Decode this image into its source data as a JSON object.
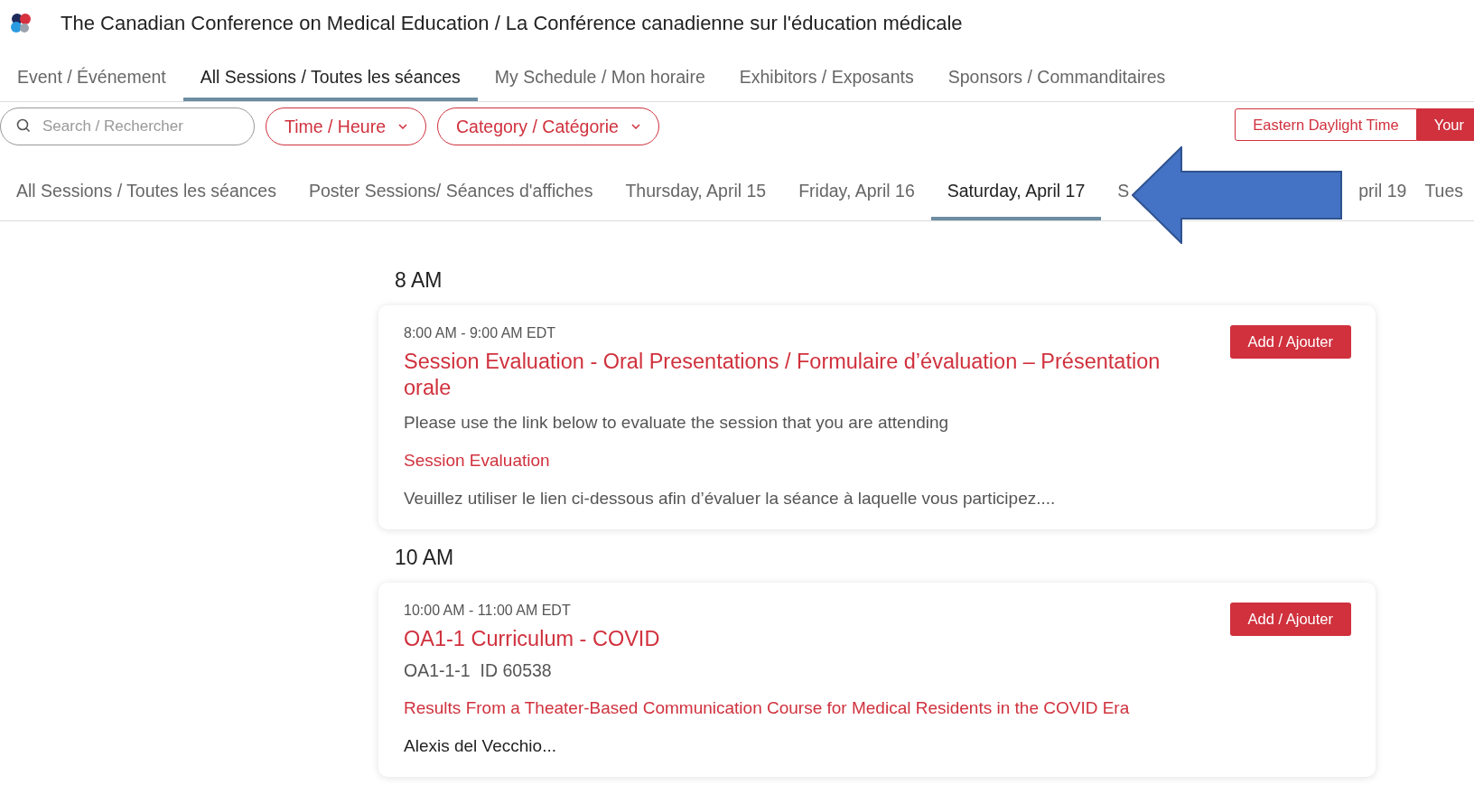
{
  "header": {
    "title": "The Canadian Conference on Medical Education / La Conférence canadienne sur l'éducation médicale"
  },
  "nav_tabs": [
    {
      "label": "Event / Événement",
      "selected": false
    },
    {
      "label": "All Sessions / Toutes les séances",
      "selected": true
    },
    {
      "label": "My Schedule / Mon horaire",
      "selected": false
    },
    {
      "label": "Exhibitors / Exposants",
      "selected": false
    },
    {
      "label": "Sponsors / Commanditaires",
      "selected": false
    }
  ],
  "filters": {
    "search_placeholder": "Search / Rechercher",
    "dropdowns": [
      "Time / Heure",
      "Category / Catégorie"
    ]
  },
  "timezone_toggle": [
    {
      "label": "Eastern Daylight Time",
      "selected": false
    },
    {
      "label": "Your",
      "selected": true
    }
  ],
  "date_tabs": [
    {
      "label": "All Sessions / Toutes les séances",
      "selected": false
    },
    {
      "label": "Poster Sessions/ Séances d'affiches",
      "selected": false
    },
    {
      "label": "Thursday, April 15",
      "selected": false
    },
    {
      "label": "Friday, April 16",
      "selected": false
    },
    {
      "label": "Saturday, April 17",
      "selected": true
    },
    {
      "label": "S",
      "selected": false,
      "kind": "covered_start"
    },
    {
      "label": "pril 19",
      "selected": false,
      "kind": "covered_end"
    },
    {
      "label": "Tues",
      "selected": false
    }
  ],
  "sessions": [
    {
      "hour": "8 AM",
      "time": "8:00 AM - 9:00 AM EDT",
      "title": "Session Evaluation - Oral Presentations / Formulaire d’évaluation – Présentation orale",
      "button": "Add / Ajouter",
      "lines": [
        {
          "kind": "text",
          "text": "Please use the link below to evaluate the session that you are attending"
        },
        {
          "kind": "link",
          "text": "Session Evaluation"
        },
        {
          "kind": "text",
          "text": "Veuillez utiliser le lien ci-dessous afin d’évaluer la séance à laquelle vous participez...."
        }
      ]
    },
    {
      "hour": "10 AM",
      "time": "10:00 AM - 11:00 AM EDT",
      "title": "OA1-1 Curriculum - COVID",
      "button": "Add / Ajouter",
      "lines": [
        {
          "kind": "code",
          "text": "OA1-1-1  ID 60538"
        },
        {
          "kind": "link",
          "text": "Results From a Theater-Based Communication Course for Medical Residents in the COVID Era"
        },
        {
          "kind": "author",
          "text": "Alexis del Vecchio..."
        }
      ]
    }
  ]
}
